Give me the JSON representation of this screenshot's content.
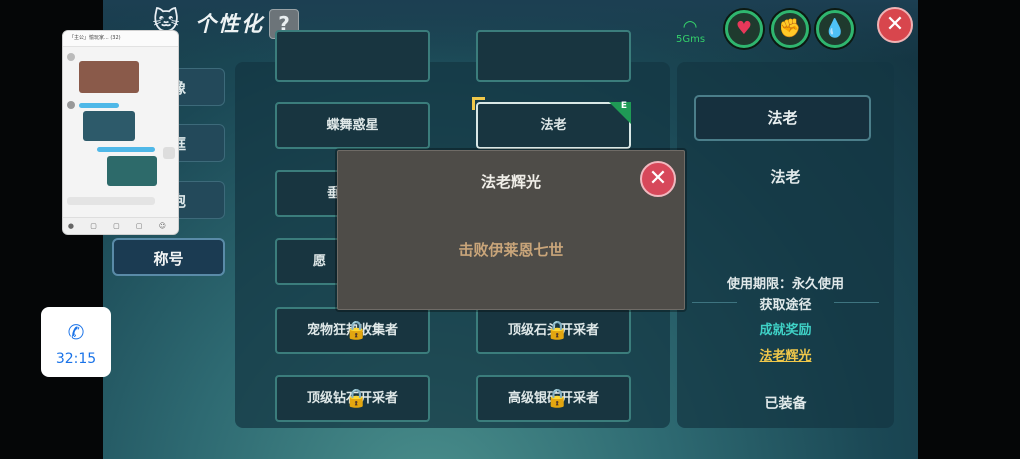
{
  "header": {
    "title": "个性化",
    "help_label": "?",
    "network_label": "5Gms",
    "stats": {
      "heart": "♥",
      "stamina": "✊",
      "water": "💧"
    },
    "close_label": "✕"
  },
  "tabs": [
    {
      "label": "像"
    },
    {
      "label": "框"
    },
    {
      "label": "气泡"
    },
    {
      "label": "称号"
    }
  ],
  "grid": {
    "cells": [
      {
        "label": "蝶舞惑星"
      },
      {
        "label": "法老",
        "equipped_badge": "E"
      },
      {
        "label": "垂"
      },
      {
        "label": "愿"
      },
      {
        "label": "宠物狂热收集者"
      },
      {
        "label": "顶级石头开采者"
      },
      {
        "label": "顶级钻石开采者"
      },
      {
        "label": "高级银矿开采者"
      }
    ]
  },
  "detail": {
    "selected_title": "法老",
    "title_text": "法老",
    "usage_period": "使用期限：永久使用",
    "source_label": "获取途径",
    "source_type": "成就奖励",
    "source_name": "法老辉光",
    "status": "已装备"
  },
  "popup": {
    "title": "法老辉光",
    "description": "击败伊莱恩七世",
    "close_label": "✕"
  },
  "call": {
    "time": "32:15"
  },
  "chat_overlay": {
    "header": "「主公」愉玩家... (32)"
  },
  "colors": {
    "accent_green": "#2fb66f",
    "close_red": "#d8464d",
    "popup_text": "#c9a57a",
    "link_teal": "#3fd1c6"
  }
}
